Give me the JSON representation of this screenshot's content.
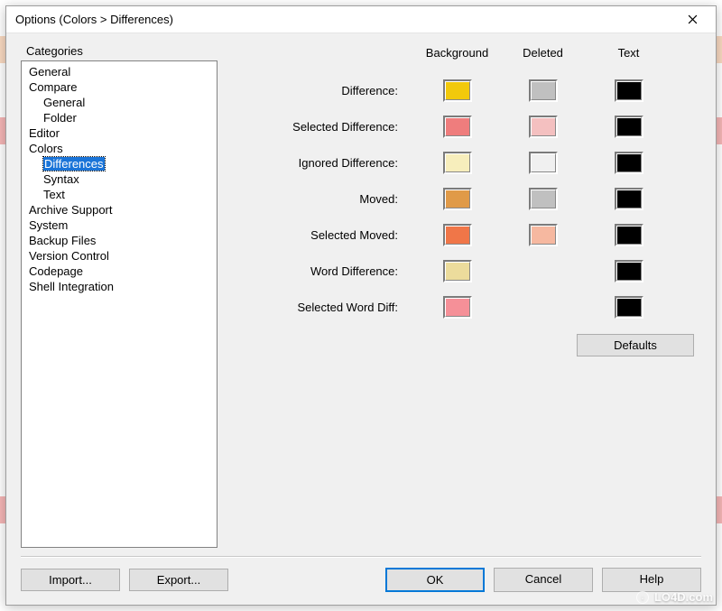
{
  "window": {
    "title": "Options (Colors > Differences)"
  },
  "categories": {
    "label": "Categories",
    "items": [
      {
        "label": "General",
        "indent": 0,
        "selected": false
      },
      {
        "label": "Compare",
        "indent": 0,
        "selected": false
      },
      {
        "label": "General",
        "indent": 1,
        "selected": false
      },
      {
        "label": "Folder",
        "indent": 1,
        "selected": false
      },
      {
        "label": "Editor",
        "indent": 0,
        "selected": false
      },
      {
        "label": "Colors",
        "indent": 0,
        "selected": false
      },
      {
        "label": "Differences",
        "indent": 1,
        "selected": true
      },
      {
        "label": "Syntax",
        "indent": 1,
        "selected": false
      },
      {
        "label": "Text",
        "indent": 1,
        "selected": false
      },
      {
        "label": "Archive Support",
        "indent": 0,
        "selected": false
      },
      {
        "label": "System",
        "indent": 0,
        "selected": false
      },
      {
        "label": "Backup Files",
        "indent": 0,
        "selected": false
      },
      {
        "label": "Version Control",
        "indent": 0,
        "selected": false
      },
      {
        "label": "Codepage",
        "indent": 0,
        "selected": false
      },
      {
        "label": "Shell Integration",
        "indent": 0,
        "selected": false
      }
    ]
  },
  "columns": {
    "background": "Background",
    "deleted": "Deleted",
    "text": "Text"
  },
  "rows": [
    {
      "label": "Difference:",
      "bg": "#f2c90b",
      "del": "#c0c0c0",
      "txt": "#000000"
    },
    {
      "label": "Selected Difference:",
      "bg": "#ef7d7d",
      "del": "#f4c0c0",
      "txt": "#000000"
    },
    {
      "label": "Ignored Difference:",
      "bg": "#f7eebc",
      "del": "#f0f0f0",
      "txt": "#000000"
    },
    {
      "label": "Moved:",
      "bg": "#e09a48",
      "del": "#c0c0c0",
      "txt": "#000000"
    },
    {
      "label": "Selected Moved:",
      "bg": "#f07648",
      "del": "#f6b8a0",
      "txt": "#000000"
    },
    {
      "label": "Word Difference:",
      "bg": "#ecdc9c",
      "del": null,
      "txt": "#000000"
    },
    {
      "label": "Selected Word Diff:",
      "bg": "#f59098",
      "del": null,
      "txt": "#000000"
    }
  ],
  "buttons": {
    "defaults": "Defaults",
    "import": "Import...",
    "export": "Export...",
    "ok": "OK",
    "cancel": "Cancel",
    "help": "Help"
  },
  "watermark": "LO4D.com"
}
